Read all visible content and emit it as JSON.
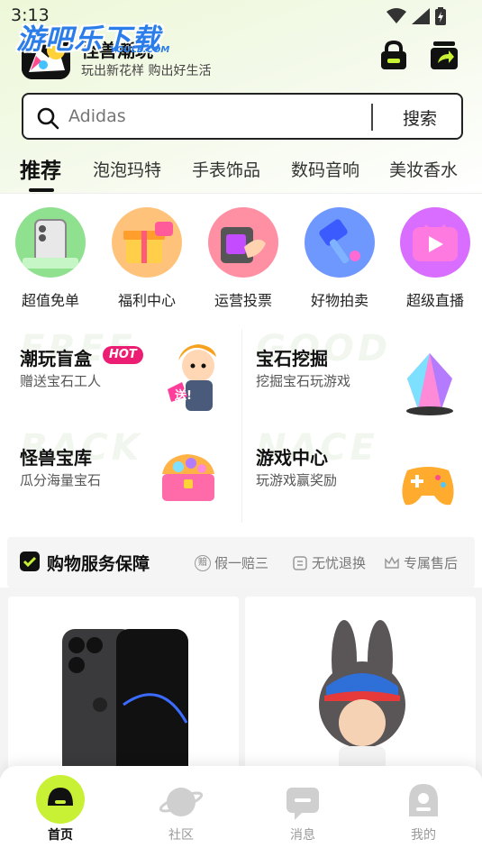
{
  "status_bar": {
    "time": "3:13"
  },
  "watermark": {
    "text": "游吧乐下载",
    "sub": "YOULE.COM"
  },
  "header": {
    "app_name": "怪兽潮玩",
    "slogan": "玩出新花样 购出好生活",
    "icons": [
      "lock-icon",
      "share-icon"
    ]
  },
  "search": {
    "placeholder": "Adidas",
    "button_label": "搜索"
  },
  "tabs": [
    "推荐",
    "泡泡玛特",
    "手表饰品",
    "数码音响",
    "美妆香水"
  ],
  "categories": [
    {
      "label": "超值免单",
      "color": "#8fe08f"
    },
    {
      "label": "福利中心",
      "color": "#ffc27a"
    },
    {
      "label": "运营投票",
      "color": "#ff8fa3"
    },
    {
      "label": "好物拍卖",
      "color": "#6f98ff"
    },
    {
      "label": "超级直播",
      "color": "#d86dff"
    }
  ],
  "promos": [
    {
      "title": "潮玩盲盒",
      "subtitle": "赠送宝石工人",
      "badge": "HOT",
      "ghost": "FREE"
    },
    {
      "title": "宝石挖掘",
      "subtitle": "挖掘宝石玩游戏",
      "ghost": "GOOD"
    },
    {
      "title": "怪兽宝库",
      "subtitle": "瓜分海量宝石",
      "ghost": "BACK"
    },
    {
      "title": "游戏中心",
      "subtitle": "玩游戏赢奖励",
      "ghost": "NACE"
    }
  ],
  "promo_badge_text": "送!",
  "service": {
    "title": "购物服务保障",
    "items": [
      "假一赔三",
      "无忧退换",
      "专属售后"
    ],
    "fake_icon_text": "赔"
  },
  "bottom_nav": [
    {
      "label": "首页",
      "active": true
    },
    {
      "label": "社区",
      "active": false
    },
    {
      "label": "消息",
      "active": false
    },
    {
      "label": "我的",
      "active": false
    }
  ],
  "colors": {
    "accent": "#c8f034",
    "hot": "#ec1e73",
    "watermark": "#2b7de9"
  }
}
